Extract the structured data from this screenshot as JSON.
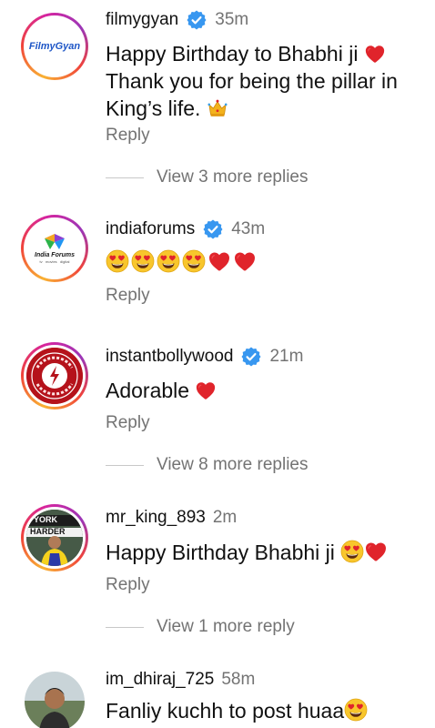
{
  "comments": [
    {
      "username": "filmygyan",
      "time": "35m",
      "verified": true,
      "avatar_text": "FilmyGyan",
      "text_line1": "Happy Birthday to Bhabhi ji",
      "text_line2": "Thank you for being the pillar in",
      "text_line3": "King’s life.",
      "reply_label": "Reply",
      "view_more": "View 3 more replies"
    },
    {
      "username": "indiaforums",
      "time": "43m",
      "verified": true,
      "avatar_title": "India Forums",
      "avatar_sub": "tv   movies   digital",
      "reply_label": "Reply"
    },
    {
      "username": "instantbollywood",
      "time": "21m",
      "verified": true,
      "text": "Adorable",
      "reply_label": "Reply",
      "view_more": "View 8 more replies"
    },
    {
      "username": "mr_king_893",
      "time": "2m",
      "verified": false,
      "avatar_text_top": "YORK",
      "avatar_text_mid": "HARDER",
      "text": "Happy Birthday Bhabhi ji",
      "reply_label": "Reply",
      "view_more": "View 1 more reply"
    },
    {
      "username": "im_dhiraj_725",
      "time": "58m",
      "verified": false,
      "text": "Fanliy kuchh to post huaa"
    }
  ],
  "icons": {
    "verified": "verified-badge-icon",
    "heart": "red-heart-emoji",
    "heart_eyes": "heart-eyes-emoji",
    "crown": "crown-emoji"
  },
  "colors": {
    "verified_blue": "#3897f0",
    "muted_text": "#737373",
    "heart_red": "#e0242b"
  }
}
